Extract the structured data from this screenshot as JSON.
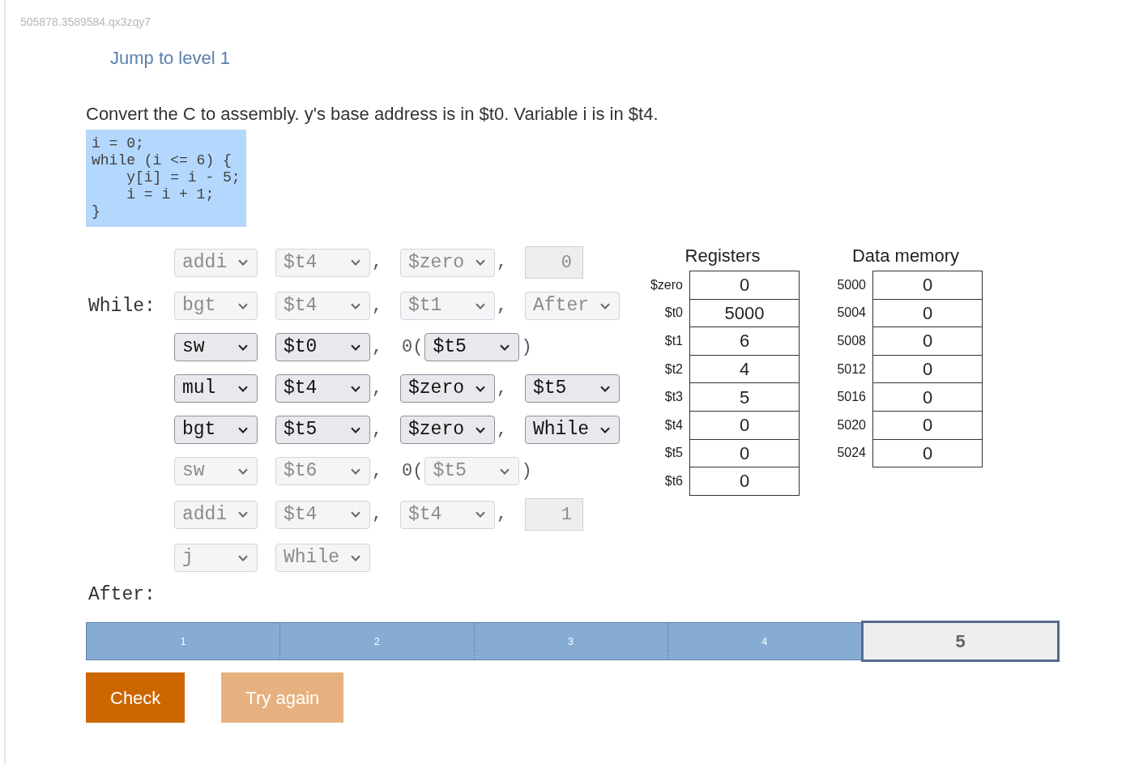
{
  "activity_code": "505878.3589584.qx3zqy7",
  "jump_link": "Jump to level 1",
  "instructions": "Convert the C to assembly. y's base address is in $t0. Variable i is in $t4.",
  "c_code": [
    "i = 0;",
    "while (i <= 6) {",
    "    y[i] = i - 5;",
    "    i = i + 1;",
    "}"
  ],
  "program": {
    "rows": [
      {
        "disabled": true,
        "opcode": "addi",
        "operands": [
          [
            {
              "kind": "select",
              "text": "$t4"
            },
            {
              "kind": "text",
              "text": ","
            }
          ],
          [
            {
              "kind": "select",
              "text": "$zero"
            },
            {
              "kind": "text",
              "text": ","
            }
          ],
          [
            {
              "kind": "number",
              "text": "0"
            }
          ]
        ]
      },
      {
        "label": "While:",
        "disabled": true,
        "opcode": "bgt",
        "operands": [
          [
            {
              "kind": "select",
              "text": "$t4"
            },
            {
              "kind": "text",
              "text": ","
            }
          ],
          [
            {
              "kind": "select",
              "text": "$t1"
            },
            {
              "kind": "text",
              "text": ","
            }
          ],
          [
            {
              "kind": "select",
              "text": "After"
            }
          ]
        ]
      },
      {
        "disabled": false,
        "opcode": "sw",
        "operands": [
          [
            {
              "kind": "select",
              "text": "$t0"
            },
            {
              "kind": "text",
              "text": ","
            }
          ],
          [
            {
              "kind": "text",
              "text": "0("
            },
            {
              "kind": "select",
              "text": "$t5"
            },
            {
              "kind": "text",
              "text": ")"
            }
          ]
        ]
      },
      {
        "disabled": false,
        "opcode": "mul",
        "operands": [
          [
            {
              "kind": "select",
              "text": "$t4"
            },
            {
              "kind": "text",
              "text": ","
            }
          ],
          [
            {
              "kind": "select",
              "text": "$zero"
            },
            {
              "kind": "text",
              "text": ","
            }
          ],
          [
            {
              "kind": "select",
              "text": "$t5"
            }
          ]
        ]
      },
      {
        "disabled": false,
        "opcode": "bgt",
        "operands": [
          [
            {
              "kind": "select",
              "text": "$t5"
            },
            {
              "kind": "text",
              "text": ","
            }
          ],
          [
            {
              "kind": "select",
              "text": "$zero"
            },
            {
              "kind": "text",
              "text": ","
            }
          ],
          [
            {
              "kind": "select",
              "text": "While"
            }
          ]
        ]
      },
      {
        "disabled": true,
        "opcode": "sw",
        "operands": [
          [
            {
              "kind": "select",
              "text": "$t6"
            },
            {
              "kind": "text",
              "text": ","
            }
          ],
          [
            {
              "kind": "text",
              "text": "0("
            },
            {
              "kind": "select",
              "text": "$t5"
            },
            {
              "kind": "text",
              "text": ")"
            }
          ]
        ]
      },
      {
        "disabled": true,
        "opcode": "addi",
        "operands": [
          [
            {
              "kind": "select",
              "text": "$t4"
            },
            {
              "kind": "text",
              "text": ","
            }
          ],
          [
            {
              "kind": "select",
              "text": "$t4"
            },
            {
              "kind": "text",
              "text": ","
            }
          ],
          [
            {
              "kind": "number",
              "text": "1"
            }
          ]
        ]
      },
      {
        "disabled": true,
        "opcode": "j",
        "operands": [
          [
            {
              "kind": "select",
              "text": "While"
            }
          ]
        ]
      }
    ],
    "end_label": "After:"
  },
  "registers": {
    "title": "Registers",
    "rows": [
      {
        "name": "$zero",
        "value": "0"
      },
      {
        "name": "$t0",
        "value": "5000"
      },
      {
        "name": "$t1",
        "value": "6"
      },
      {
        "name": "$t2",
        "value": "4"
      },
      {
        "name": "$t3",
        "value": "5"
      },
      {
        "name": "$t4",
        "value": "0"
      },
      {
        "name": "$t5",
        "value": "0"
      },
      {
        "name": "$t6",
        "value": "0"
      }
    ]
  },
  "data_memory": {
    "title": "Data memory",
    "rows": [
      {
        "address": "5000",
        "value": "0"
      },
      {
        "address": "5004",
        "value": "0"
      },
      {
        "address": "5008",
        "value": "0"
      },
      {
        "address": "5012",
        "value": "0"
      },
      {
        "address": "5016",
        "value": "0"
      },
      {
        "address": "5020",
        "value": "0"
      },
      {
        "address": "5024",
        "value": "0"
      }
    ]
  },
  "levels": [
    {
      "label": "1",
      "selected": false
    },
    {
      "label": "2",
      "selected": false
    },
    {
      "label": "3",
      "selected": false
    },
    {
      "label": "4",
      "selected": false
    },
    {
      "label": "5",
      "selected": true
    }
  ],
  "buttons": [
    {
      "label": "Check",
      "disabled": false
    },
    {
      "label": "Try again",
      "disabled": true
    }
  ]
}
